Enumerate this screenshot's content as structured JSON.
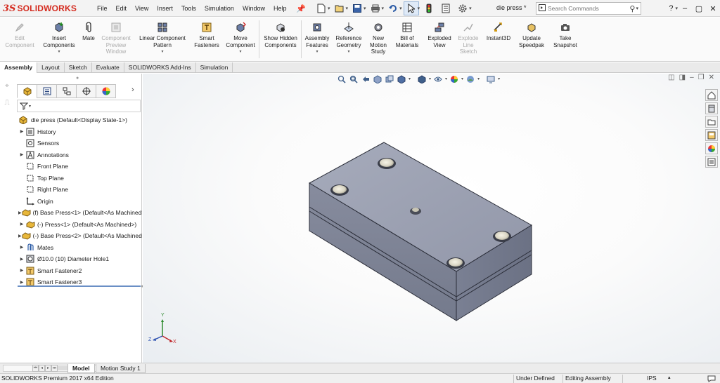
{
  "app": {
    "logo_ds": "3S",
    "logo_text": "SOLIDWORKS"
  },
  "menu": [
    "File",
    "Edit",
    "View",
    "Insert",
    "Tools",
    "Simulation",
    "Window",
    "Help"
  ],
  "quick_access": [
    "new-document-icon",
    "open-icon",
    "save-icon",
    "print-icon",
    "undo-icon",
    "select-icon",
    "traffic-light-icon",
    "file-properties-icon",
    "options-gear-icon"
  ],
  "document_title": "die press *",
  "search": {
    "placeholder": "Search Commands"
  },
  "window_controls": [
    "?",
    "–",
    "▢",
    "✕"
  ],
  "ribbon": {
    "edit_component": "Edit Component",
    "insert_components": "Insert Components",
    "mate": "Mate",
    "component_preview": "Component Preview Window",
    "linear_pattern": "Linear Component Pattern",
    "smart_fasteners": "Smart Fasteners",
    "move_component": "Move Component",
    "show_hidden": "Show Hidden Components",
    "assembly_features": "Assembly Features",
    "reference_geometry": "Reference Geometry",
    "new_motion_study": "New Motion Study",
    "bill_of_materials": "Bill of Materials",
    "exploded_view": "Exploded View",
    "explode_line_sketch": "Explode Line Sketch",
    "instant3d": "Instant3D",
    "update_speedpak": "Update Speedpak",
    "take_snapshot": "Take Snapshot"
  },
  "tabs": [
    "Assembly",
    "Layout",
    "Sketch",
    "Evaluate",
    "SOLIDWORKS Add-Ins",
    "Simulation"
  ],
  "tree": {
    "root": "die press  (Default<Display State-1>)",
    "items": [
      "History",
      "Sensors",
      "Annotations",
      "Front Plane",
      "Top Plane",
      "Right Plane",
      "Origin",
      "(f) Base Press<1> (Default<As Machined>)",
      "(-) Press<1> (Default<As Machined>)",
      "(-) Base Press<2> (Default<As Machined>)",
      "Mates",
      "Ø10.0 (10) Diameter Hole1",
      "Smart Fastener2",
      "Smart Fastener3"
    ]
  },
  "triad": {
    "x": "X",
    "y": "Y",
    "z": "Z"
  },
  "bottom_tabs": [
    "Model",
    "Motion Study 1"
  ],
  "status": {
    "edition": "SOLIDWORKS Premium 2017 x64 Edition",
    "defined": "Under Defined",
    "mode": "Editing Assembly",
    "units": "IPS"
  },
  "colors": {
    "brand_red": "#d42a1e",
    "model_top": "#9ea3b4",
    "model_front": "#7f8497",
    "model_side": "#70768a"
  }
}
